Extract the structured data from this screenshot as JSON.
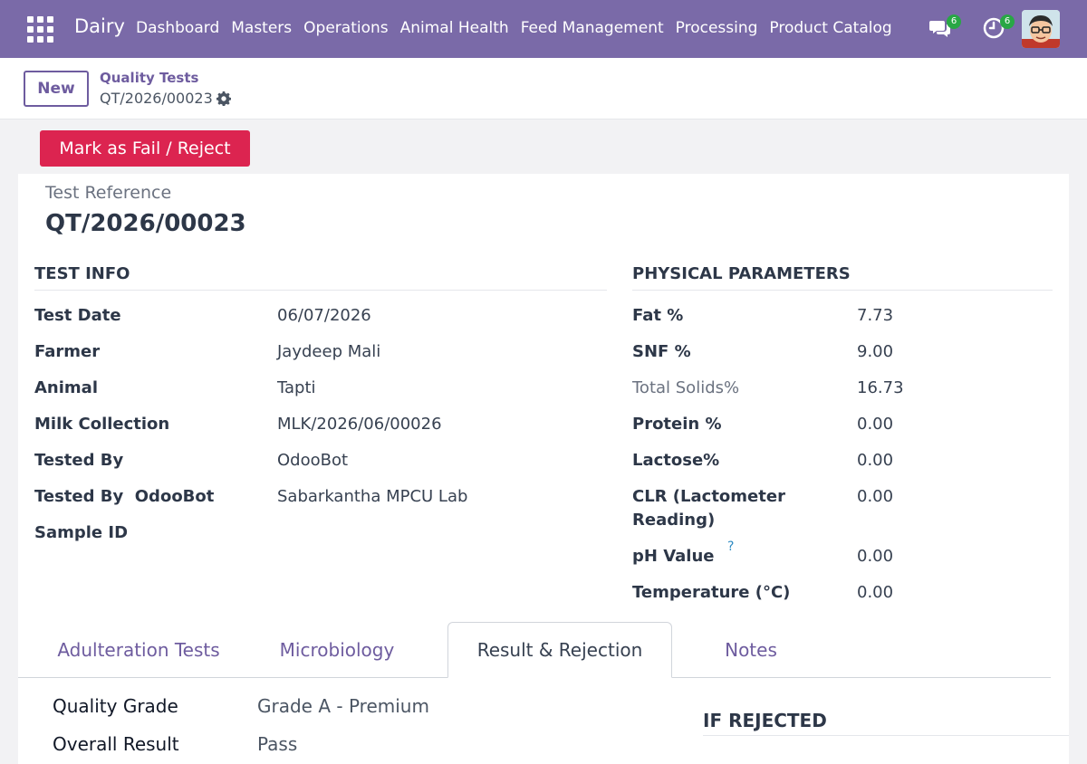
{
  "navbar": {
    "brand": "Dairy",
    "menu": [
      "Dashboard",
      "Masters",
      "Operations",
      "Animal Health",
      "Feed Management",
      "Processing",
      "Product Catalog"
    ],
    "messages_badge": "6",
    "activities_badge": "6"
  },
  "control": {
    "new_label": "New",
    "breadcrumb_parent": "Quality Tests",
    "breadcrumb_current": "QT/2026/00023"
  },
  "statusbar": {
    "reject_label": "Mark as Fail / Reject"
  },
  "form": {
    "ref_label": "Test Reference",
    "ref_value": "QT/2026/00023",
    "test_info": {
      "title": "TEST INFO",
      "rows": [
        {
          "label": "Test Date",
          "value": "06/07/2026"
        },
        {
          "label": "Farmer",
          "value": "Jaydeep Mali"
        },
        {
          "label": "Animal",
          "value": "Tapti"
        },
        {
          "label": "Milk Collection",
          "value": "MLK/2026/06/00026"
        },
        {
          "label": "Tested By",
          "value": "OdooBot"
        },
        {
          "label": "Tested By  OdooBot",
          "value": "Sabarkantha MPCU Lab"
        },
        {
          "label": "Sample ID",
          "value": ""
        }
      ]
    },
    "physical": {
      "title": "PHYSICAL PARAMETERS",
      "rows": [
        {
          "label": "Fat %",
          "value": "7.73"
        },
        {
          "label": "SNF %",
          "value": "9.00"
        },
        {
          "label": "Total Solids%",
          "value": "16.73"
        },
        {
          "label": "Protein %",
          "value": "0.00"
        },
        {
          "label": "Lactose%",
          "value": "0.00"
        },
        {
          "label": "CLR (Lactometer Reading)",
          "value": "0.00"
        },
        {
          "label": "pH Value",
          "value": "0.00"
        },
        {
          "label": "Temperature (°C)",
          "value": "0.00"
        }
      ],
      "help_mark": "?"
    }
  },
  "tabs": [
    "Adulteration Tests",
    "Microbiology",
    "Result & Rejection",
    "Notes"
  ],
  "result_tab": {
    "quality_grade_label": "Quality Grade",
    "quality_grade_value": "Grade A - Premium",
    "overall_result_label": "Overall Result",
    "overall_result_value": "Pass",
    "rejected_title": "IF REJECTED"
  }
}
